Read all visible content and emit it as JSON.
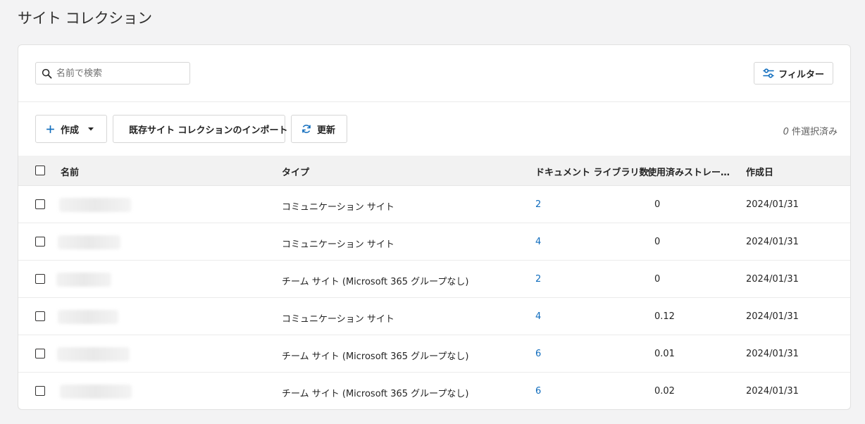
{
  "page": {
    "title": "サイト コレクション"
  },
  "search": {
    "placeholder": "名前で検索"
  },
  "filter": {
    "label": "フィルター"
  },
  "toolbar": {
    "create_label": "作成",
    "import_label": "既存サイト コレクションのインポート",
    "refresh_label": "更新"
  },
  "selection": {
    "count": "0",
    "suffix": "件選択済み"
  },
  "table": {
    "headers": {
      "name": "名前",
      "type": "タイプ",
      "doc_libraries": "ドキュメント ライブラリ数",
      "storage": "使用済みストレー…",
      "created": "作成日"
    },
    "rows": [
      {
        "type": "コミュニケーション サイト",
        "doc_libraries": "2",
        "storage": "0",
        "created": "2024/01/31"
      },
      {
        "type": "コミュニケーション サイト",
        "doc_libraries": "4",
        "storage": "0",
        "created": "2024/01/31"
      },
      {
        "type": "チーム サイト (Microsoft 365 グループなし)",
        "doc_libraries": "2",
        "storage": "0",
        "created": "2024/01/31"
      },
      {
        "type": "コミュニケーション サイト",
        "doc_libraries": "4",
        "storage": "0.12",
        "created": "2024/01/31"
      },
      {
        "type": "チーム サイト (Microsoft 365 グループなし)",
        "doc_libraries": "6",
        "storage": "0.01",
        "created": "2024/01/31"
      },
      {
        "type": "チーム サイト (Microsoft 365 グループなし)",
        "doc_libraries": "6",
        "storage": "0.02",
        "created": "2024/01/31"
      }
    ]
  },
  "colors": {
    "accent": "#0f6cbd",
    "background": "#f3f3f4"
  },
  "icons": {
    "search": "search-icon",
    "filter": "filter-icon",
    "add": "plus-icon",
    "dropdown": "caret-down-icon",
    "refresh": "refresh-icon"
  }
}
